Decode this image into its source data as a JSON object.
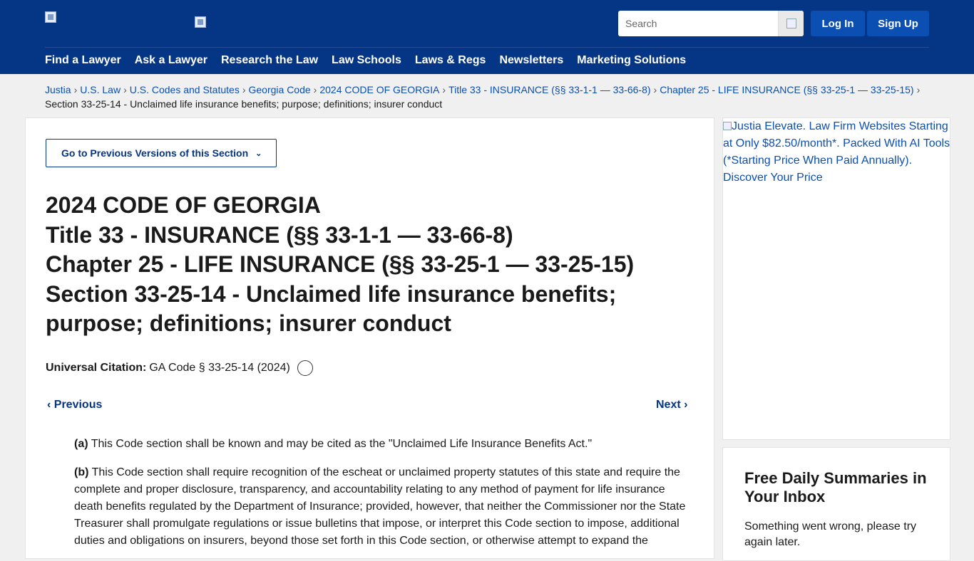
{
  "header": {
    "search_placeholder": "Search",
    "login_label": "Log In",
    "signup_label": "Sign Up",
    "nav": [
      "Find a Lawyer",
      "Ask a Lawyer",
      "Research the Law",
      "Law Schools",
      "Laws & Regs",
      "Newsletters",
      "Marketing Solutions"
    ]
  },
  "breadcrumb": {
    "items": [
      "Justia",
      "U.S. Law",
      "U.S. Codes and Statutes",
      "Georgia Code",
      "2024 CODE OF GEORGIA",
      "Title 33 - INSURANCE (§§ 33-1-1 — 33-66-8)",
      "Chapter 25 - LIFE INSURANCE (§§ 33-25-1 — 33-25-15)"
    ],
    "current": "Section 33-25-14 - Unclaimed life insurance benefits; purpose; definitions; insurer conduct"
  },
  "main": {
    "prev_versions_label": "Go to Previous Versions of this Section",
    "title_lines": [
      "2024 CODE OF GEORGIA",
      "Title 33 - INSURANCE (§§ 33-1-1 — 33-66-8)",
      "Chapter 25 - LIFE INSURANCE (§§ 33-25-1 — 33-25-15)",
      "Section 33-25-14 - Unclaimed life insurance benefits; purpose; definitions; insurer conduct"
    ],
    "citation_label": "Universal Citation:",
    "citation_value": "GA Code § 33-25-14 (2024)",
    "previous_label": "Previous",
    "next_label": "Next",
    "paragraphs": [
      {
        "marker": "(a)",
        "text": "This Code section shall be known and may be cited as the \"Unclaimed Life Insurance Benefits Act.\""
      },
      {
        "marker": "(b)",
        "text": "This Code section shall require recognition of the escheat or unclaimed property statutes of this state and require the complete and proper disclosure, transparency, and accountability relating to any method of payment for life insurance death benefits regulated by the Department of Insurance; provided, however, that neither the Commissioner nor the State Treasurer shall promulgate regulations or issue bulletins that impose, or interpret this Code section to impose, additional duties and obligations on insurers, beyond those set forth in this Code section, or otherwise attempt to expand the"
      }
    ]
  },
  "sidebar": {
    "ad_alt": "Justia Elevate. Law Firm Websites Starting at Only $82.50/month*. Packed With AI Tools (*Starting Price When Paid Annually). Discover Your Price",
    "newsletter_title": "Free Daily Summaries in Your Inbox",
    "newsletter_error": "Something went wrong, please try again later."
  }
}
